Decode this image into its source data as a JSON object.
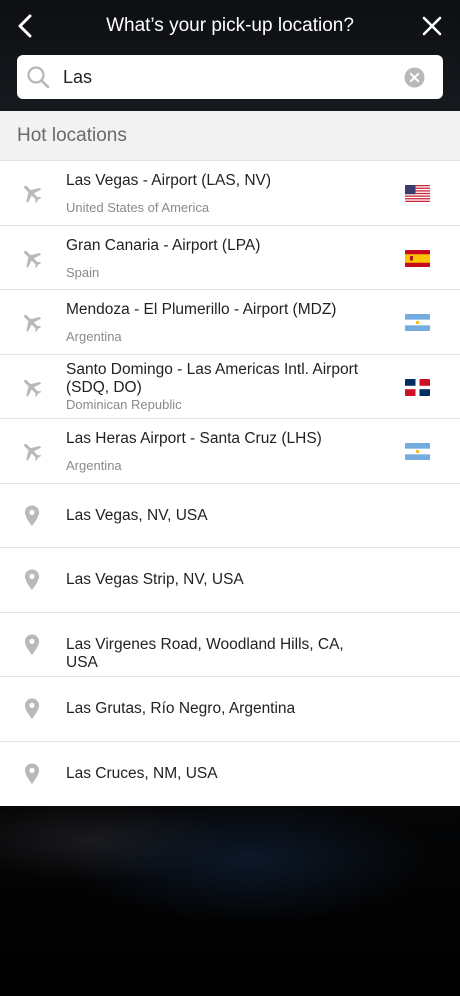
{
  "header": {
    "title": "What’s your pick-up location?"
  },
  "search": {
    "value": "Las"
  },
  "section": {
    "title": "Hot locations"
  },
  "airports": [
    {
      "name": "Las Vegas - Airport (LAS, NV)",
      "country": "United States of America",
      "flag": "flag-usa-icon"
    },
    {
      "name": "Gran Canaria - Airport (LPA)",
      "country": "Spain",
      "flag": "flag-spain-icon"
    },
    {
      "name": "Mendoza - El Plumerillo - Airport (MDZ)",
      "country": "Argentina",
      "flag": "flag-argentina-icon"
    },
    {
      "name": "Santo Domingo - Las Americas Intl. Airport (SDQ, DO)",
      "country": "Dominican Republic",
      "flag": "flag-dominican-republic-icon"
    },
    {
      "name": "Las Heras Airport - Santa Cruz (LHS)",
      "country": "Argentina",
      "flag": "flag-argentina-icon"
    }
  ],
  "places": [
    {
      "name": "Las Vegas, NV, USA"
    },
    {
      "name": "Las Vegas Strip, NV, USA"
    },
    {
      "name": "Las Virgenes Road, Woodland Hills, CA, USA"
    },
    {
      "name": "Las Grutas, Río Negro, Argentina"
    },
    {
      "name": "Las Cruces, NM, USA"
    }
  ],
  "colors": {
    "icon_gray": "#b9b9b9",
    "header_bg": "#121418",
    "section_bg": "#f2f2f2"
  }
}
